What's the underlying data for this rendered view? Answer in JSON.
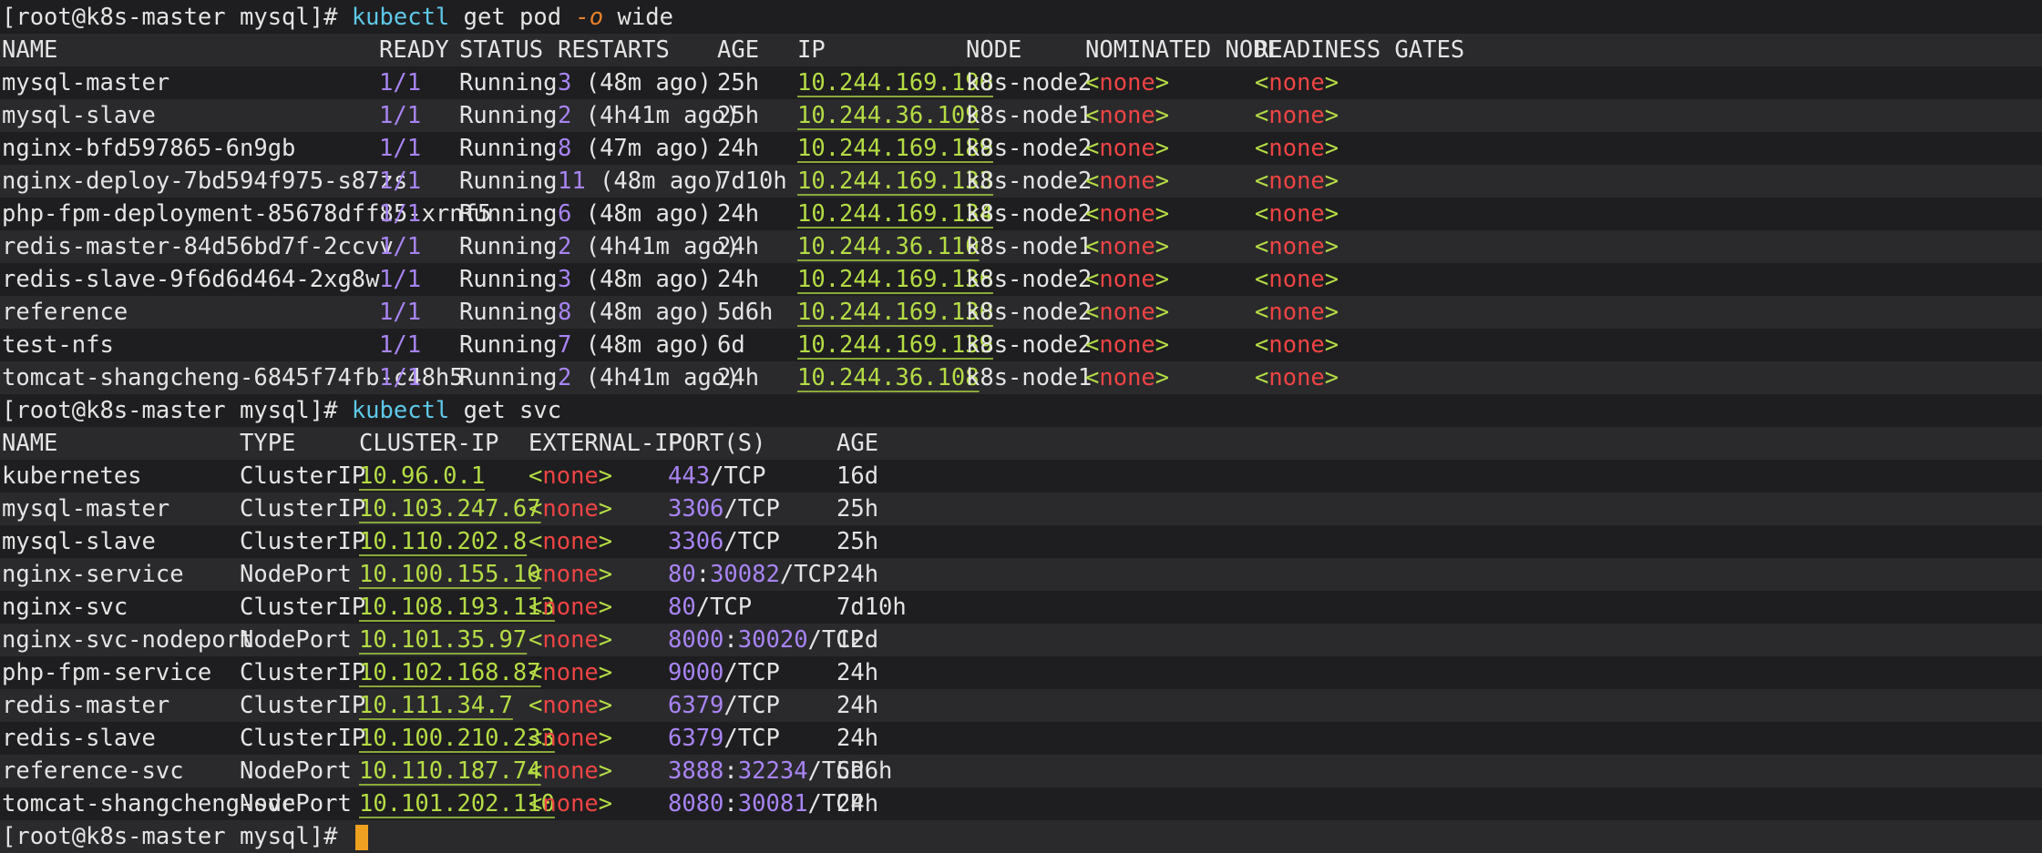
{
  "prompt": "[root@k8s-master mysql]# ",
  "cmd1": {
    "bin": "kubectl",
    "rest1": " get pod ",
    "flag": "-o",
    "rest2": " wide"
  },
  "cmd2": {
    "bin": "kubectl",
    "rest1": " get svc"
  },
  "pods": {
    "headers": [
      "NAME",
      "READY",
      "STATUS",
      "RESTARTS",
      "AGE",
      "IP",
      "NODE",
      "NOMINATED NODE",
      "READINESS GATES"
    ],
    "rows": [
      {
        "name": "mysql-master",
        "ready": "1/1",
        "status": "Running",
        "restarts": "3",
        "ago": "(48m ago)",
        "age": "25h",
        "ip": "10.244.169.190",
        "node": "k8s-node2",
        "nominated": "<none>",
        "gates": "<none>"
      },
      {
        "name": "mysql-slave",
        "ready": "1/1",
        "status": "Running",
        "restarts": "2",
        "ago": "(4h41m ago)",
        "age": "25h",
        "ip": "10.244.36.109",
        "node": "k8s-node1",
        "nominated": "<none>",
        "gates": "<none>"
      },
      {
        "name": "nginx-bfd597865-6n9gb",
        "ready": "1/1",
        "status": "Running",
        "restarts": "8",
        "ago": "(47m ago)",
        "age": "24h",
        "ip": "10.244.169.189",
        "node": "k8s-node2",
        "nominated": "<none>",
        "gates": "<none>"
      },
      {
        "name": "nginx-deploy-7bd594f975-s87zs",
        "ready": "1/1",
        "status": "Running",
        "restarts": "11",
        "ago": "(48m ago)",
        "age": "7d10h",
        "ip": "10.244.169.133",
        "node": "k8s-node2",
        "nominated": "<none>",
        "gates": "<none>"
      },
      {
        "name": "php-fpm-deployment-85678dff85-xrnf5",
        "ready": "1/1",
        "status": "Running",
        "restarts": "6",
        "ago": "(48m ago)",
        "age": "24h",
        "ip": "10.244.169.134",
        "node": "k8s-node2",
        "nominated": "<none>",
        "gates": "<none>"
      },
      {
        "name": "redis-master-84d56bd7f-2ccvv",
        "ready": "1/1",
        "status": "Running",
        "restarts": "2",
        "ago": "(4h41m ago)",
        "age": "24h",
        "ip": "10.244.36.110",
        "node": "k8s-node1",
        "nominated": "<none>",
        "gates": "<none>"
      },
      {
        "name": "redis-slave-9f6d6d464-2xg8w",
        "ready": "1/1",
        "status": "Running",
        "restarts": "3",
        "ago": "(48m ago)",
        "age": "24h",
        "ip": "10.244.169.136",
        "node": "k8s-node2",
        "nominated": "<none>",
        "gates": "<none>"
      },
      {
        "name": "reference",
        "ready": "1/1",
        "status": "Running",
        "restarts": "8",
        "ago": "(48m ago)",
        "age": "5d6h",
        "ip": "10.244.169.130",
        "node": "k8s-node2",
        "nominated": "<none>",
        "gates": "<none>"
      },
      {
        "name": "test-nfs",
        "ready": "1/1",
        "status": "Running",
        "restarts": "7",
        "ago": "(48m ago)",
        "age": "6d",
        "ip": "10.244.169.139",
        "node": "k8s-node2",
        "nominated": "<none>",
        "gates": "<none>"
      },
      {
        "name": "tomcat-shangcheng-6845f74fb-c48h5",
        "ready": "1/1",
        "status": "Running",
        "restarts": "2",
        "ago": "(4h41m ago)",
        "age": "24h",
        "ip": "10.244.36.108",
        "node": "k8s-node1",
        "nominated": "<none>",
        "gates": "<none>"
      }
    ]
  },
  "svcs": {
    "headers": [
      "NAME",
      "TYPE",
      "CLUSTER-IP",
      "EXTERNAL-IP",
      "PORT(S)",
      "AGE"
    ],
    "rows": [
      {
        "name": "kubernetes",
        "type": "ClusterIP",
        "cip": "10.96.0.1",
        "eip": "<none>",
        "port": "443",
        "nodeport": "",
        "proto": "/TCP",
        "age": "16d"
      },
      {
        "name": "mysql-master",
        "type": "ClusterIP",
        "cip": "10.103.247.67",
        "eip": "<none>",
        "port": "3306",
        "nodeport": "",
        "proto": "/TCP",
        "age": "25h"
      },
      {
        "name": "mysql-slave",
        "type": "ClusterIP",
        "cip": "10.110.202.8",
        "eip": "<none>",
        "port": "3306",
        "nodeport": "",
        "proto": "/TCP",
        "age": "25h"
      },
      {
        "name": "nginx-service",
        "type": "NodePort",
        "cip": "10.100.155.10",
        "eip": "<none>",
        "port": "80",
        "nodeport": "30082",
        "proto": "/TCP",
        "age": "24h"
      },
      {
        "name": "nginx-svc",
        "type": "ClusterIP",
        "cip": "10.108.193.113",
        "eip": "<none>",
        "port": "80",
        "nodeport": "",
        "proto": "/TCP",
        "age": "7d10h"
      },
      {
        "name": "nginx-svc-nodeport",
        "type": "NodePort",
        "cip": "10.101.35.97",
        "eip": "<none>",
        "port": "8000",
        "nodeport": "30020",
        "proto": "/TCP",
        "age": "12d"
      },
      {
        "name": "php-fpm-service",
        "type": "ClusterIP",
        "cip": "10.102.168.87",
        "eip": "<none>",
        "port": "9000",
        "nodeport": "",
        "proto": "/TCP",
        "age": "24h"
      },
      {
        "name": "redis-master",
        "type": "ClusterIP",
        "cip": "10.111.34.7",
        "eip": "<none>",
        "port": "6379",
        "nodeport": "",
        "proto": "/TCP",
        "age": "24h"
      },
      {
        "name": "redis-slave",
        "type": "ClusterIP",
        "cip": "10.100.210.233",
        "eip": "<none>",
        "port": "6379",
        "nodeport": "",
        "proto": "/TCP",
        "age": "24h"
      },
      {
        "name": "reference-svc",
        "type": "NodePort",
        "cip": "10.110.187.74",
        "eip": "<none>",
        "port": "3888",
        "nodeport": "32234",
        "proto": "/TCP",
        "age": "5d6h"
      },
      {
        "name": "tomcat-shangcheng-svc",
        "type": "NodePort",
        "cip": "10.101.202.110",
        "eip": "<none>",
        "port": "8080",
        "nodeport": "30081",
        "proto": "/TCP",
        "age": "24h"
      }
    ]
  },
  "colors": {
    "background": "#1e1e20",
    "alt_row": "#2a2a2d",
    "command": "#5fc8e8",
    "flag": "#e8812c",
    "number": "#a884f3",
    "ip": "#b5dc45",
    "none": "#ee4444",
    "cursor": "#f0a020"
  }
}
